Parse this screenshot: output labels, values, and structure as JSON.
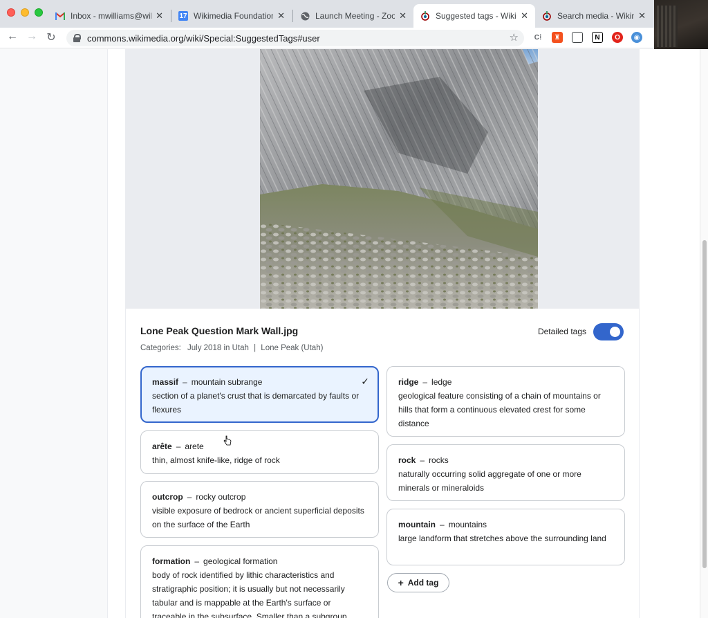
{
  "browser": {
    "tabs": [
      {
        "title": "Inbox - mwilliams@wik",
        "icon": "gmail-icon",
        "active": false
      },
      {
        "title": "Wikimedia Foundation",
        "icon": "calendar-icon",
        "active": false
      },
      {
        "title": "Launch Meeting - Zoo",
        "icon": "globe-icon",
        "active": false
      },
      {
        "title": "Suggested tags - Wikim",
        "icon": "wikimedia-icon",
        "active": true
      },
      {
        "title": "Search media - Wikime",
        "icon": "wikimedia-icon",
        "active": false
      }
    ],
    "url": "commons.wikimedia.org/wiki/Special:SuggestedTags#user",
    "colors": {
      "tab_strip": "#dee1e6",
      "accent": "#3366cc"
    }
  },
  "file": {
    "title": "Lone Peak Question Mark Wall.jpg",
    "categories_label": "Categories:",
    "categories": [
      "July 2018 in Utah",
      "Lone Peak (Utah)"
    ],
    "category_separator": "|"
  },
  "detailed_tags": {
    "label": "Detailed tags",
    "enabled": true
  },
  "tags_left": [
    {
      "term": "massif",
      "label": "mountain subrange",
      "desc": "section of a planet's crust that is demarcated by faults or flexures",
      "selected": true
    },
    {
      "term": "arête",
      "label": "arete",
      "desc": "thin, almost knife-like, ridge of rock",
      "selected": false
    },
    {
      "term": "outcrop",
      "label": "rocky outcrop",
      "desc": "visible exposure of bedrock or ancient superficial deposits on the surface of the Earth",
      "selected": false
    },
    {
      "term": "formation",
      "label": "geological formation",
      "desc": "body of rock identified by lithic characteristics and stratigraphic position; it is usually but not necessarily tabular and is mappable at the Earth's surface or traceable in the subsurface. Smaller than a subgroup",
      "selected": false
    }
  ],
  "tags_right": [
    {
      "term": "ridge",
      "label": "ledge",
      "desc": "geological feature consisting of a chain of mountains or hills that form a continuous elevated crest for some distance",
      "selected": false
    },
    {
      "term": "rock",
      "label": "rocks",
      "desc": "naturally occurring solid aggregate of one or more minerals or mineraloids",
      "selected": false
    },
    {
      "term": "mountain",
      "label": "mountains",
      "desc": "large landform that stretches above the surrounding land",
      "selected": false
    }
  ],
  "add_tag": {
    "label": "Add tag",
    "icon": "plus-icon"
  }
}
